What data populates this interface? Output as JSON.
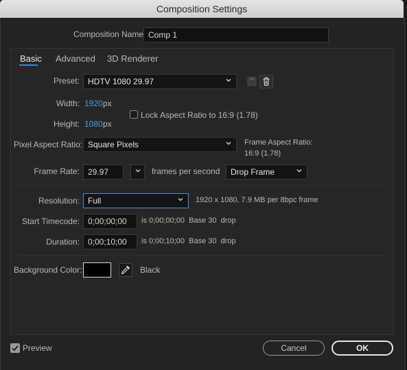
{
  "window": {
    "title": "Composition Settings"
  },
  "comp_name": {
    "label": "Composition Name:",
    "value": "Comp 1"
  },
  "tabs": [
    {
      "label": "Basic",
      "active": true
    },
    {
      "label": "Advanced",
      "active": false
    },
    {
      "label": "3D Renderer",
      "active": false
    }
  ],
  "preset": {
    "label": "Preset:",
    "value": "HDTV 1080 29.97"
  },
  "width": {
    "label": "Width:",
    "value": "1920",
    "unit": "px"
  },
  "height": {
    "label": "Height:",
    "value": "1080",
    "unit": "px"
  },
  "lock_aspect": {
    "label": "Lock Aspect Ratio to 16:9 (1.78)",
    "checked": false
  },
  "pixel_aspect": {
    "label": "Pixel Aspect Ratio:",
    "value": "Square Pixels"
  },
  "frame_aspect": {
    "label": "Frame Aspect Ratio:",
    "value": "16:9 (1.78)"
  },
  "frame_rate": {
    "label": "Frame Rate:",
    "value": "29.97",
    "unit": "frames per second",
    "drop": "Drop Frame"
  },
  "resolution": {
    "label": "Resolution:",
    "value": "Full",
    "info": "1920 x 1080, 7.9 MB per 8bpc frame"
  },
  "start_timecode": {
    "label": "Start Timecode:",
    "value": "0;00;00;00",
    "info": "is 0;00;00;00  Base 30  drop"
  },
  "duration": {
    "label": "Duration:",
    "value": "0;00;10;00",
    "info": "is 0;00;10;00  Base 30  drop"
  },
  "background": {
    "label": "Background Color:",
    "color": "#000000",
    "name": "Black"
  },
  "preview": {
    "label": "Preview",
    "checked": true
  },
  "buttons": {
    "cancel": "Cancel",
    "ok": "OK"
  },
  "colors": {
    "accent": "#2d8ceb",
    "link": "#4a9eea",
    "panel": "#262626",
    "bg": "#1d1d1d"
  }
}
